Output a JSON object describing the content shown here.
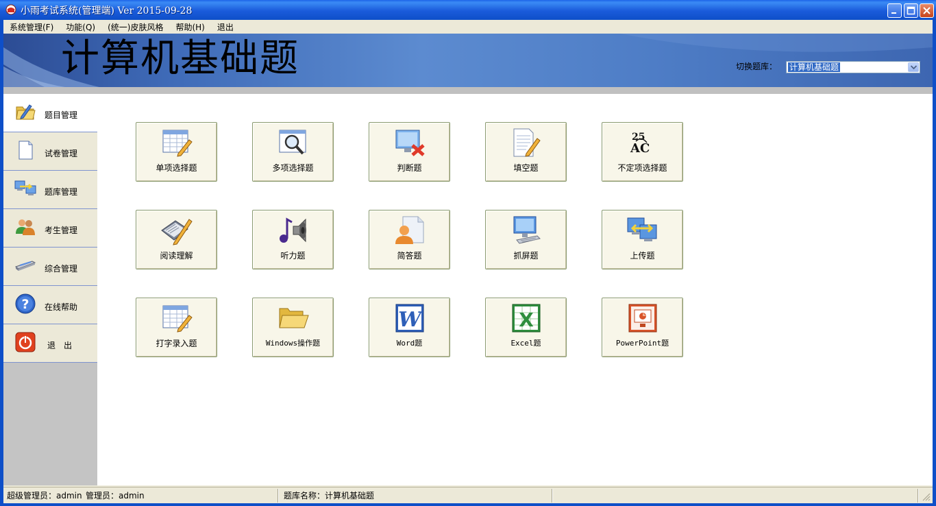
{
  "window": {
    "title": "小雨考试系统(管理端) Ver 2015-09-28"
  },
  "menu": [
    {
      "label": "系统管理(F)"
    },
    {
      "label": "功能(Q)"
    },
    {
      "label": "(统一)皮肤风格"
    },
    {
      "label": "帮助(H)"
    },
    {
      "label": "退出"
    }
  ],
  "banner": {
    "title": "计算机基础题",
    "switch_label": "切换题库：",
    "selected_bank": "计算机基础题"
  },
  "sidebar": [
    {
      "label": "题目管理",
      "icon": "folder-pencil-icon",
      "active": true
    },
    {
      "label": "试卷管理",
      "icon": "document-icon",
      "active": false
    },
    {
      "label": "题库管理",
      "icon": "computer-transfer-icon",
      "active": false
    },
    {
      "label": "考生管理",
      "icon": "users-icon",
      "active": false
    },
    {
      "label": "综合管理",
      "icon": "scanner-icon",
      "active": false
    },
    {
      "label": "在线帮助",
      "icon": "help-icon",
      "active": false
    },
    {
      "label": "退　出",
      "icon": "power-icon",
      "active": false
    }
  ],
  "tiles": [
    {
      "label": "单项选择题",
      "icon": "table-pencil-icon"
    },
    {
      "label": "多项选择题",
      "icon": "magnifier-icon"
    },
    {
      "label": "判断题",
      "icon": "monitor-x-icon"
    },
    {
      "label": "填空题",
      "icon": "page-pencil-icon"
    },
    {
      "label": "不定项选择题",
      "icon": "abc-icon"
    },
    {
      "label": "阅读理解",
      "icon": "book-pencil-icon"
    },
    {
      "label": "听力题",
      "icon": "speaker-note-icon"
    },
    {
      "label": "简答题",
      "icon": "person-page-icon"
    },
    {
      "label": "抓屏题",
      "icon": "monitor-keyboard-icon"
    },
    {
      "label": "上传题",
      "icon": "upload-computers-icon"
    },
    {
      "label": "打字录入题",
      "icon": "table-pencil-icon"
    },
    {
      "label": "Windows操作题",
      "icon": "open-folder-icon"
    },
    {
      "label": "Word题",
      "icon": "word-icon"
    },
    {
      "label": "Excel题",
      "icon": "excel-icon"
    },
    {
      "label": "PowerPoint题",
      "icon": "powerpoint-icon"
    }
  ],
  "status": {
    "super_admin": "超级管理员：admin",
    "admin": "管理员：admin",
    "bank_name": "题库名称：计算机基础题"
  },
  "colors": {
    "titlebar": "#0E4FC8",
    "banner": "#4E7DC6",
    "tile_bg": "#F8F6E9",
    "selection": "#316AC5"
  }
}
